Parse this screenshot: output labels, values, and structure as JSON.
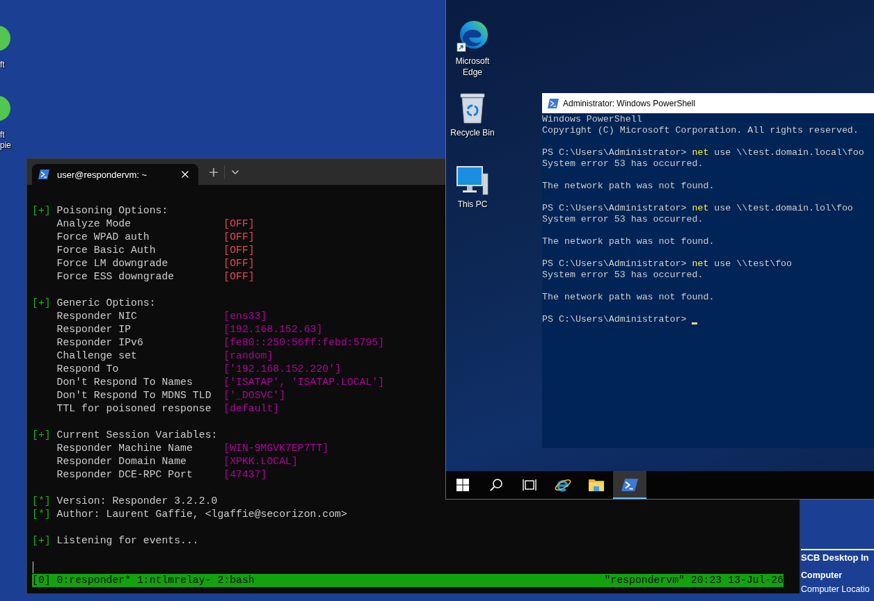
{
  "host_desktop": {
    "icons": [
      {
        "label_lines": [
          "ft"
        ]
      },
      {
        "label_lines": [
          "ft",
          "pie"
        ]
      }
    ],
    "info_panel": {
      "title": "SCB Desktop In",
      "lines": [
        {
          "kind": "heading",
          "text": "Computer"
        },
        {
          "kind": "field",
          "text": "Computer Locatio"
        }
      ]
    }
  },
  "terminal": {
    "tabs": [
      {
        "title": "user@respondervm: ~",
        "selected": true
      }
    ],
    "blocks": [
      {
        "lines": [
          {
            "marker": "[+]",
            "text": "Poisoning Options:"
          }
        ],
        "options": [
          {
            "label": "Analyze Mode",
            "value": "[OFF]",
            "kind": "off"
          },
          {
            "label": "Force WPAD auth",
            "value": "[OFF]",
            "kind": "off"
          },
          {
            "label": "Force Basic Auth",
            "value": "[OFF]",
            "kind": "off"
          },
          {
            "label": "Force LM downgrade",
            "value": "[OFF]",
            "kind": "off"
          },
          {
            "label": "Force ESS downgrade",
            "value": "[OFF]",
            "kind": "off"
          }
        ]
      },
      {
        "lines": [
          {
            "marker": "[+]",
            "text": "Generic Options:"
          }
        ],
        "options": [
          {
            "label": "Responder NIC",
            "value": "[ens33]",
            "kind": "setting"
          },
          {
            "label": "Responder IP",
            "value": "[192.168.152.63]",
            "kind": "setting"
          },
          {
            "label": "Responder IPv6",
            "value": "[fe80::250:56ff:febd:5795]",
            "kind": "setting"
          },
          {
            "label": "Challenge set",
            "value": "[random]",
            "kind": "setting"
          },
          {
            "label": "Respond To",
            "value": "['192.168.152.220']",
            "kind": "setting"
          },
          {
            "label": "Don't Respond To Names",
            "value": "['ISATAP', 'ISATAP.LOCAL']",
            "kind": "setting"
          },
          {
            "label": "Don't Respond To MDNS TLD",
            "value": "['_DOSVC']",
            "kind": "setting"
          },
          {
            "label": "TTL for poisoned response",
            "value": "[default]",
            "kind": "setting"
          }
        ]
      },
      {
        "lines": [
          {
            "marker": "[+]",
            "text": "Current Session Variables:"
          }
        ],
        "options": [
          {
            "label": "Responder Machine Name",
            "value": "[WIN-9MGVK7EP7TT]",
            "kind": "setting"
          },
          {
            "label": "Responder Domain Name",
            "value": "[XPKK.LOCAL]",
            "kind": "setting"
          },
          {
            "label": "Responder DCE-RPC Port",
            "value": "[47437]",
            "kind": "setting"
          }
        ]
      },
      {
        "lines": [
          {
            "marker": "[*]",
            "text": "Version: Responder 3.2.2.0"
          },
          {
            "marker": "[*]",
            "text": "Author: Laurent Gaffie, <lgaffie@secorizon.com>"
          }
        ]
      },
      {
        "lines": [
          {
            "marker": "[+]",
            "text": "Listening for events..."
          }
        ]
      }
    ],
    "cursor_visible": true,
    "status_bar": {
      "left": "[0] 0:responder* 1:ntlmrelay- 2:bash",
      "right": "\"respondervm\" 20:23 13-Jul-26"
    }
  },
  "vm": {
    "desktop_icons": [
      {
        "kind": "browser",
        "label": "Microsoft Edge"
      },
      {
        "kind": "recycle-bin",
        "label": "Recycle Bin"
      },
      {
        "kind": "computer",
        "label": "This PC"
      }
    ],
    "powershell": {
      "title": "Administrator: Windows PowerShell",
      "blocks": [
        {
          "lines": [
            {
              "kind": "output",
              "text": "Windows PowerShell"
            },
            {
              "kind": "output",
              "text": "Copyright (C) Microsoft Corporation. All rights reserved."
            }
          ]
        },
        {
          "lines": [
            {
              "kind": "command",
              "prompt": "PS C:\\Users\\Administrator>",
              "command": "net",
              "arguments": "use \\\\test.domain.local\\foo"
            },
            {
              "kind": "output",
              "text": "System error 53 has occurred."
            }
          ]
        },
        {
          "lines": [
            {
              "kind": "output",
              "text": "The network path was not found."
            }
          ]
        },
        {
          "lines": [
            {
              "kind": "command",
              "prompt": "PS C:\\Users\\Administrator>",
              "command": "net",
              "arguments": "use \\\\test.domain.lol\\foo"
            },
            {
              "kind": "output",
              "text": "System error 53 has occurred."
            }
          ]
        },
        {
          "lines": [
            {
              "kind": "output",
              "text": "The network path was not found."
            }
          ]
        },
        {
          "lines": [
            {
              "kind": "command",
              "prompt": "PS C:\\Users\\Administrator>",
              "command": "net",
              "arguments": "use \\\\test\\foo"
            },
            {
              "kind": "output",
              "text": "System error 53 has occurred."
            }
          ]
        },
        {
          "lines": [
            {
              "kind": "output",
              "text": "The network path was not found."
            }
          ]
        },
        {
          "lines": [
            {
              "kind": "command",
              "prompt": "PS C:\\Users\\Administrator>"
            }
          ]
        }
      ],
      "cursor_visible": true
    },
    "taskbar": {
      "items": [
        {
          "kind": "start",
          "selected": false
        },
        {
          "kind": "search",
          "selected": false
        },
        {
          "kind": "task-view",
          "selected": false
        },
        {
          "kind": "browser",
          "selected": false
        },
        {
          "kind": "folder",
          "selected": false
        },
        {
          "kind": "shell",
          "selected": true
        }
      ]
    }
  }
}
